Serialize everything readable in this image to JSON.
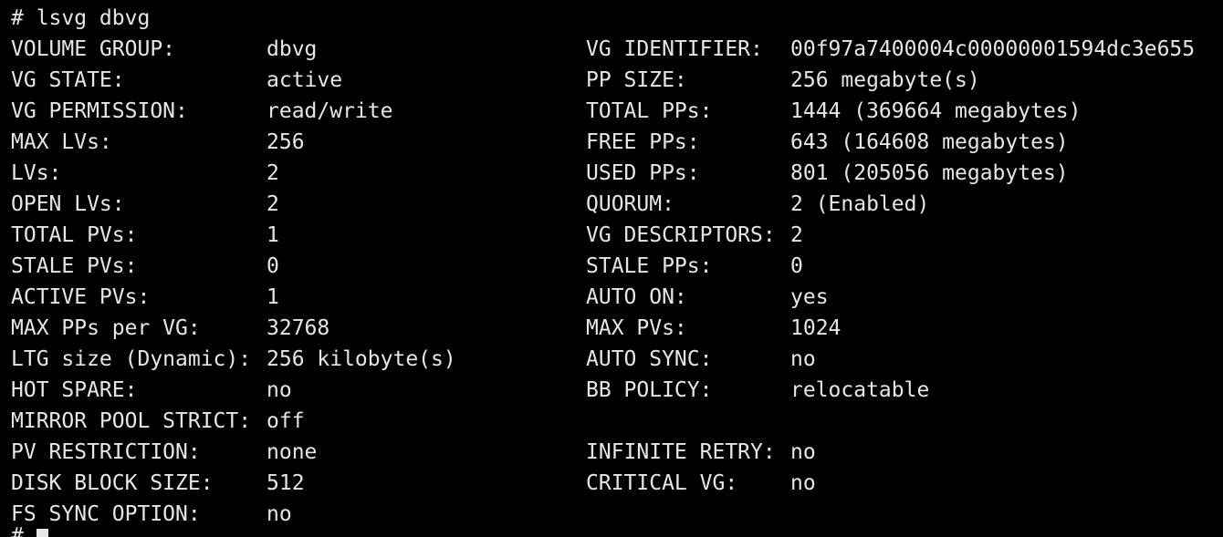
{
  "terminal": {
    "background": "#000000",
    "foreground": "#e6e6e6",
    "prompt_line": "# lsvg dbvg",
    "next_prompt": "#",
    "rows": [
      {
        "k1": "VOLUME GROUP:",
        "v1": "dbvg",
        "k2": "VG IDENTIFIER:",
        "v2": "00f97a7400004c00000001594dc3e655"
      },
      {
        "k1": "VG STATE:",
        "v1": "active",
        "k2": "PP SIZE:",
        "v2": "256 megabyte(s)"
      },
      {
        "k1": "VG PERMISSION:",
        "v1": "read/write",
        "k2": "TOTAL PPs:",
        "v2": "1444 (369664 megabytes)"
      },
      {
        "k1": "MAX LVs:",
        "v1": "256",
        "k2": "FREE PPs:",
        "v2": "643 (164608 megabytes)"
      },
      {
        "k1": "LVs:",
        "v1": "2",
        "k2": "USED PPs:",
        "v2": "801 (205056 megabytes)"
      },
      {
        "k1": "OPEN LVs:",
        "v1": "2",
        "k2": "QUORUM:",
        "v2": "2 (Enabled)"
      },
      {
        "k1": "TOTAL PVs:",
        "v1": "1",
        "k2": "VG DESCRIPTORS:",
        "v2": "2"
      },
      {
        "k1": "STALE PVs:",
        "v1": "0",
        "k2": "STALE PPs:",
        "v2": "0"
      },
      {
        "k1": "ACTIVE PVs:",
        "v1": "1",
        "k2": "AUTO ON:",
        "v2": "yes"
      },
      {
        "k1": "MAX PPs per VG:",
        "v1": "32768",
        "k2": "MAX PVs:",
        "v2": "1024"
      },
      {
        "k1": "LTG size (Dynamic):",
        "v1": "256 kilobyte(s)",
        "k2": "AUTO SYNC:",
        "v2": "no"
      },
      {
        "k1": "HOT SPARE:",
        "v1": "no",
        "k2": "BB POLICY:",
        "v2": "relocatable"
      },
      {
        "k1": "MIRROR POOL STRICT:",
        "v1": "off",
        "k2": "",
        "v2": ""
      },
      {
        "k1": "PV RESTRICTION:",
        "v1": "none",
        "k2": "INFINITE RETRY:",
        "v2": "no"
      },
      {
        "k1": "DISK BLOCK SIZE:",
        "v1": "512",
        "k2": "CRITICAL VG:",
        "v2": "no"
      },
      {
        "k1": "FS SYNC OPTION:",
        "v1": "no",
        "k2": "",
        "v2": ""
      }
    ]
  }
}
